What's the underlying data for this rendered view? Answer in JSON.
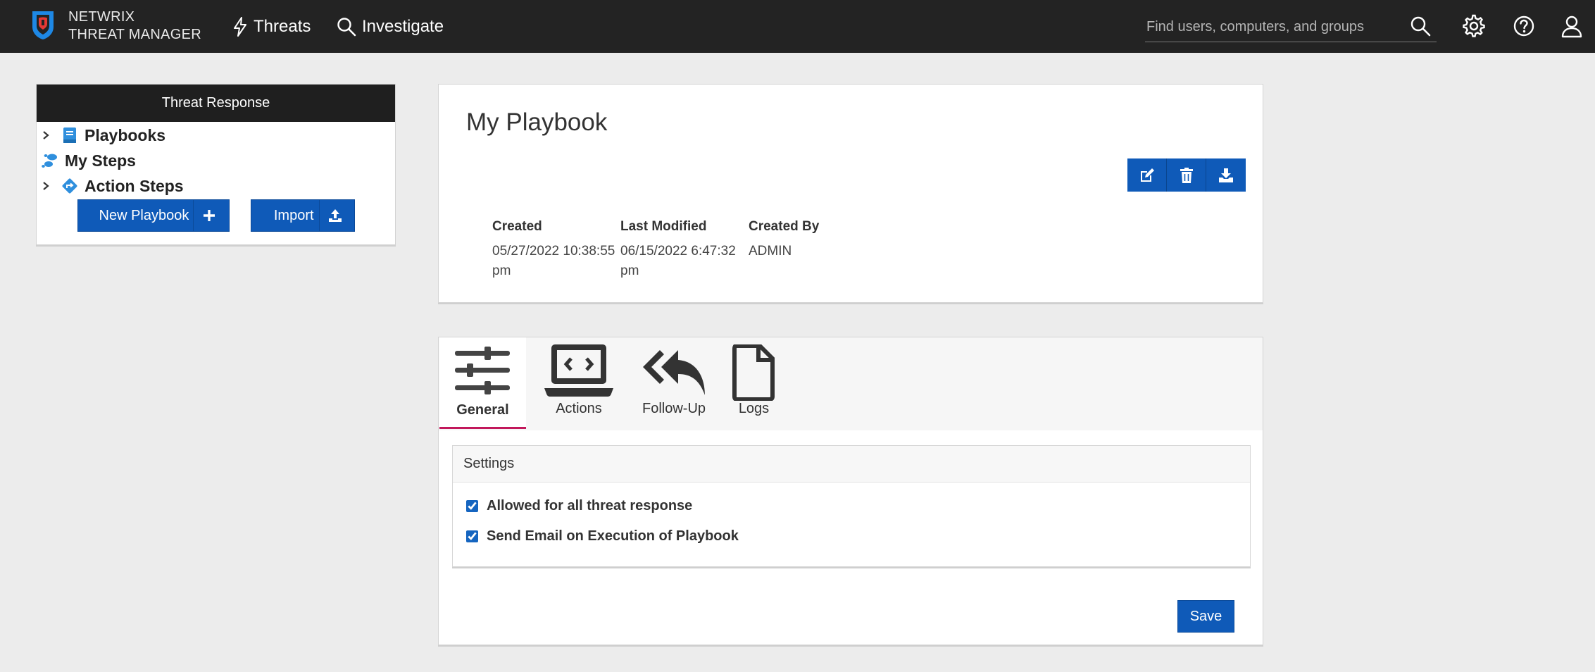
{
  "app": {
    "brand_line1": "NETWRIX",
    "brand_line2": "THREAT MANAGER"
  },
  "nav": {
    "items": [
      {
        "label": "Threats",
        "icon": "bolt-icon"
      },
      {
        "label": "Investigate",
        "icon": "search-icon"
      }
    ],
    "search_placeholder": "Find users, computers, and groups",
    "right_icons": [
      "search-icon",
      "gear-icon",
      "help-icon",
      "user-icon"
    ]
  },
  "sidebar": {
    "title": "Threat Response",
    "items": [
      {
        "label": "Playbooks",
        "icon": "book-icon",
        "expandable": true
      },
      {
        "label": "My Steps",
        "icon": "footsteps-icon",
        "expandable": false
      },
      {
        "label": "Action Steps",
        "icon": "diamond-arrow-icon",
        "expandable": true
      }
    ],
    "new_playbook_label": "New Playbook",
    "import_label": "Import"
  },
  "playbook": {
    "title": "My Playbook",
    "actions": [
      "edit-icon",
      "trash-icon",
      "download-icon"
    ],
    "meta": {
      "created_label": "Created",
      "created_value": "05/27/2022 10:38:55 pm",
      "modified_label": "Last Modified",
      "modified_value": "06/15/2022 6:47:32 pm",
      "created_by_label": "Created By",
      "created_by_value": "ADMIN"
    }
  },
  "tabs": [
    {
      "label": "General",
      "icon": "sliders-icon",
      "active": true
    },
    {
      "label": "Actions",
      "icon": "laptop-code-icon",
      "active": false
    },
    {
      "label": "Follow-Up",
      "icon": "reply-all-icon",
      "active": false
    },
    {
      "label": "Logs",
      "icon": "file-icon",
      "active": false
    }
  ],
  "settings": {
    "title": "Settings",
    "options": [
      {
        "label": "Allowed for all threat response",
        "checked": true
      },
      {
        "label": "Send Email on Execution of Playbook",
        "checked": true
      }
    ]
  },
  "save_label": "Save",
  "colors": {
    "topbar": "#232323",
    "primary": "#0f5ab8",
    "active_tab_underline": "#c2185b",
    "background": "#ececec"
  }
}
